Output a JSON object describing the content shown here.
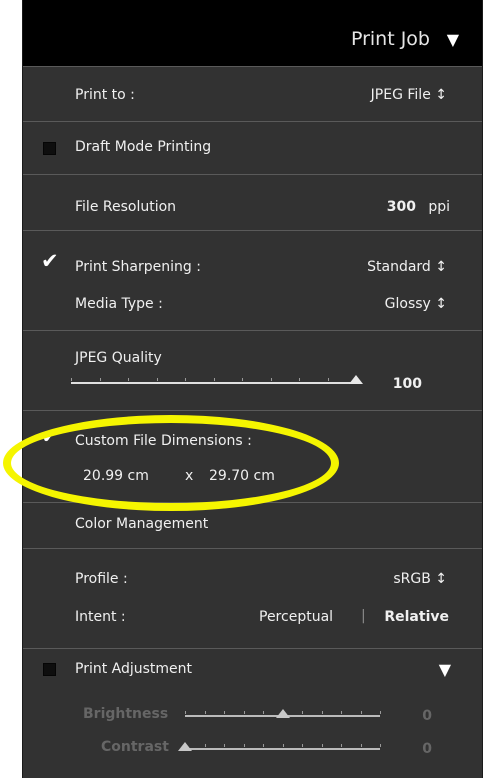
{
  "header": {
    "title": "Print Job",
    "toggle_icon": "triangle-down-icon"
  },
  "print_to": {
    "label": "Print to :",
    "value": "JPEG File ↕"
  },
  "draft_mode": {
    "label": "Draft Mode Printing",
    "checked": false
  },
  "file_resolution": {
    "label": "File Resolution",
    "value": "300",
    "unit": "ppi"
  },
  "print_sharpening": {
    "label": "Print Sharpening :",
    "value": "Standard ↕",
    "checked": true,
    "check_glyph": "✔"
  },
  "media_type": {
    "label": "Media Type :",
    "value": "Glossy ↕"
  },
  "jpeg_quality": {
    "label": "JPEG Quality",
    "value": "100",
    "fraction": 1.0
  },
  "custom_dims": {
    "label": "Custom File Dimensions :",
    "checked": true,
    "check_glyph": "✔",
    "width": "20.99 cm",
    "separator": "x",
    "height": "29.70 cm"
  },
  "color_mgmt": {
    "title": "Color Management",
    "profile_label": "Profile :",
    "profile_value": "sRGB ↕",
    "intent_label": "Intent :",
    "intent_perceptual": "Perceptual",
    "intent_divider": "|",
    "intent_relative": "Relative"
  },
  "print_adjustment": {
    "label": "Print Adjustment",
    "checked": false,
    "toggle_icon": "triangle-down-icon",
    "brightness": {
      "label": "Brightness",
      "value": "0",
      "fraction": 0.5
    },
    "contrast": {
      "label": "Contrast",
      "value": "0",
      "fraction": 0.0
    }
  },
  "colors": {
    "panel": "#323232",
    "header": "#000000",
    "highlight": "#f5f500"
  }
}
